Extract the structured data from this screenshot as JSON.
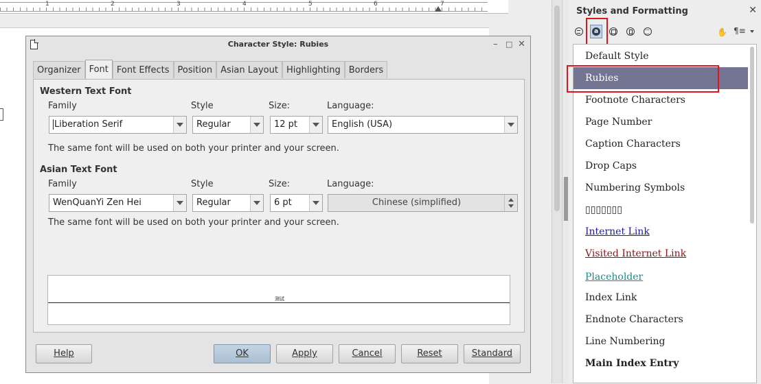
{
  "ruler": {
    "marks": [
      "1",
      "2",
      "3",
      "4",
      "5",
      "6",
      "7"
    ]
  },
  "dialog": {
    "title": "Character Style: Rubies",
    "minimize_glyph": "–",
    "maximize_glyph": "□",
    "close_glyph": "✕",
    "tabs": [
      {
        "label": "Organizer"
      },
      {
        "label": "Font",
        "active": true
      },
      {
        "label": "Font Effects"
      },
      {
        "label": "Position"
      },
      {
        "label": "Asian Layout"
      },
      {
        "label": "Highlighting"
      },
      {
        "label": "Borders"
      }
    ],
    "western": {
      "title": "Western Text Font",
      "family_label": "Family",
      "style_label": "Style",
      "size_label": "Size:",
      "language_label": "Language:",
      "family": "Liberation Serif",
      "style": "Regular",
      "size": "12 pt",
      "language": "English (USA)",
      "note": "The same font will be used on both your printer and your screen."
    },
    "asian": {
      "title": "Asian Text Font",
      "family_label": "Family",
      "style_label": "Style",
      "size_label": "Size:",
      "language_label": "Language:",
      "family": "WenQuanYi Zen Hei",
      "style": "Regular",
      "size": "6 pt",
      "language": "Chinese (simplified)",
      "note": "The same font will be used on both your printer and your screen."
    },
    "preview_text": "测试",
    "buttons": {
      "help": "Help",
      "ok": "OK",
      "apply": "Apply",
      "cancel": "Cancel",
      "reset": "Reset",
      "standard": "Standard"
    }
  },
  "sidebar": {
    "title": "Styles and Formatting",
    "close_glyph": "✕",
    "fill_format_glyph": "✋",
    "new_style_glyph": "¶≡",
    "paragraph_icon_letter": "a",
    "styles": [
      {
        "label": "Default Style",
        "kind": "normal"
      },
      {
        "label": "Rubies",
        "kind": "selected"
      },
      {
        "label": "Footnote Characters",
        "kind": "normal"
      },
      {
        "label": "Page Number",
        "kind": "normal"
      },
      {
        "label": "Caption Characters",
        "kind": "normal"
      },
      {
        "label": "Drop Caps",
        "kind": "normal"
      },
      {
        "label": "Numbering Symbols",
        "kind": "normal"
      },
      {
        "label": "▯▯▯▯▯▯▯",
        "kind": "normal"
      },
      {
        "label": "Internet Link",
        "kind": "link"
      },
      {
        "label": "Visited Internet Link",
        "kind": "visited"
      },
      {
        "label": "Placeholder",
        "kind": "ph"
      },
      {
        "label": "Index Link",
        "kind": "normal"
      },
      {
        "label": "Endnote Characters",
        "kind": "normal"
      },
      {
        "label": "Line Numbering",
        "kind": "normal"
      },
      {
        "label": "Main Index Entry",
        "kind": "bold"
      }
    ]
  }
}
